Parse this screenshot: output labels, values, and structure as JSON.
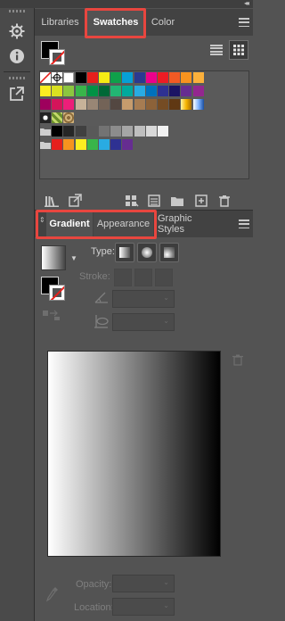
{
  "colors": {
    "highlight": "#e8463f",
    "panel": "#535353",
    "tab_bar": "#424242"
  },
  "left_toolbar": {
    "icons": [
      "ship-wheel-icon",
      "info-icon",
      "export-icon"
    ]
  },
  "top_panel": {
    "tabs": [
      {
        "label": "Libraries",
        "active": false
      },
      {
        "label": "Swatches",
        "active": true
      },
      {
        "label": "Color",
        "active": false
      }
    ],
    "view_modes": [
      "list-view-icon",
      "thumbnail-view-icon"
    ],
    "swatch_rows": [
      [
        "none",
        "registration",
        "#ffffff",
        "#000000",
        "#e6201c",
        "#f5ea14",
        "#0fa04a",
        "#06a0d6",
        "#2b3990",
        "#ec008c",
        "#ec1c24",
        "#f15a24",
        "#f7931e",
        "#fbb03b"
      ],
      [
        "#fcee21",
        "#d9e021",
        "#8cc63f",
        "#39b54a",
        "#009245",
        "#006837",
        "#22b573",
        "#00a99d",
        "#29abe2",
        "#0071bc",
        "#2e3192",
        "#1b1464",
        "#662d91",
        "#93278f"
      ],
      [
        "#9e005d",
        "#d4145a",
        "#ed1e79",
        "#c7b299",
        "#998675",
        "#736357",
        "#534741",
        "#c69c6d",
        "#a67c52",
        "#8c6239",
        "#754c24",
        "#603813",
        "gradient-gold",
        "gradient-blue"
      ],
      [
        "pattern-dots",
        "pattern-leaves",
        "pattern-swirl"
      ],
      [
        "folder",
        "#000000",
        "#262626",
        "#404040",
        "#595959",
        "#737373",
        "#8c8c8c",
        "#a6a6a6",
        "#bfbfbf",
        "#d9d9d9",
        "#f2f2f2"
      ],
      [
        "folder",
        "#e6201c",
        "#f7931e",
        "#fcee21",
        "#39b54a",
        "#29abe2",
        "#2e3192",
        "#662d91"
      ]
    ],
    "bottom_icons": [
      "swatch-libraries-icon",
      "place-swatch-icon",
      "show-kinds-icon",
      "swatch-options-icon",
      "new-color-group-icon",
      "new-swatch-icon",
      "delete-swatch-icon"
    ]
  },
  "bottom_panel": {
    "tabs": [
      {
        "label": "Gradient",
        "active": true
      },
      {
        "label": "Appearance",
        "active": false
      },
      {
        "label": "Graphic Styles",
        "active": false
      }
    ],
    "type_label": "Type:",
    "stroke_label": "Stroke:",
    "opacity_label": "Opacity:",
    "location_label": "Location:",
    "gradient": {
      "from": "#ffffff",
      "to": "#000000"
    }
  }
}
